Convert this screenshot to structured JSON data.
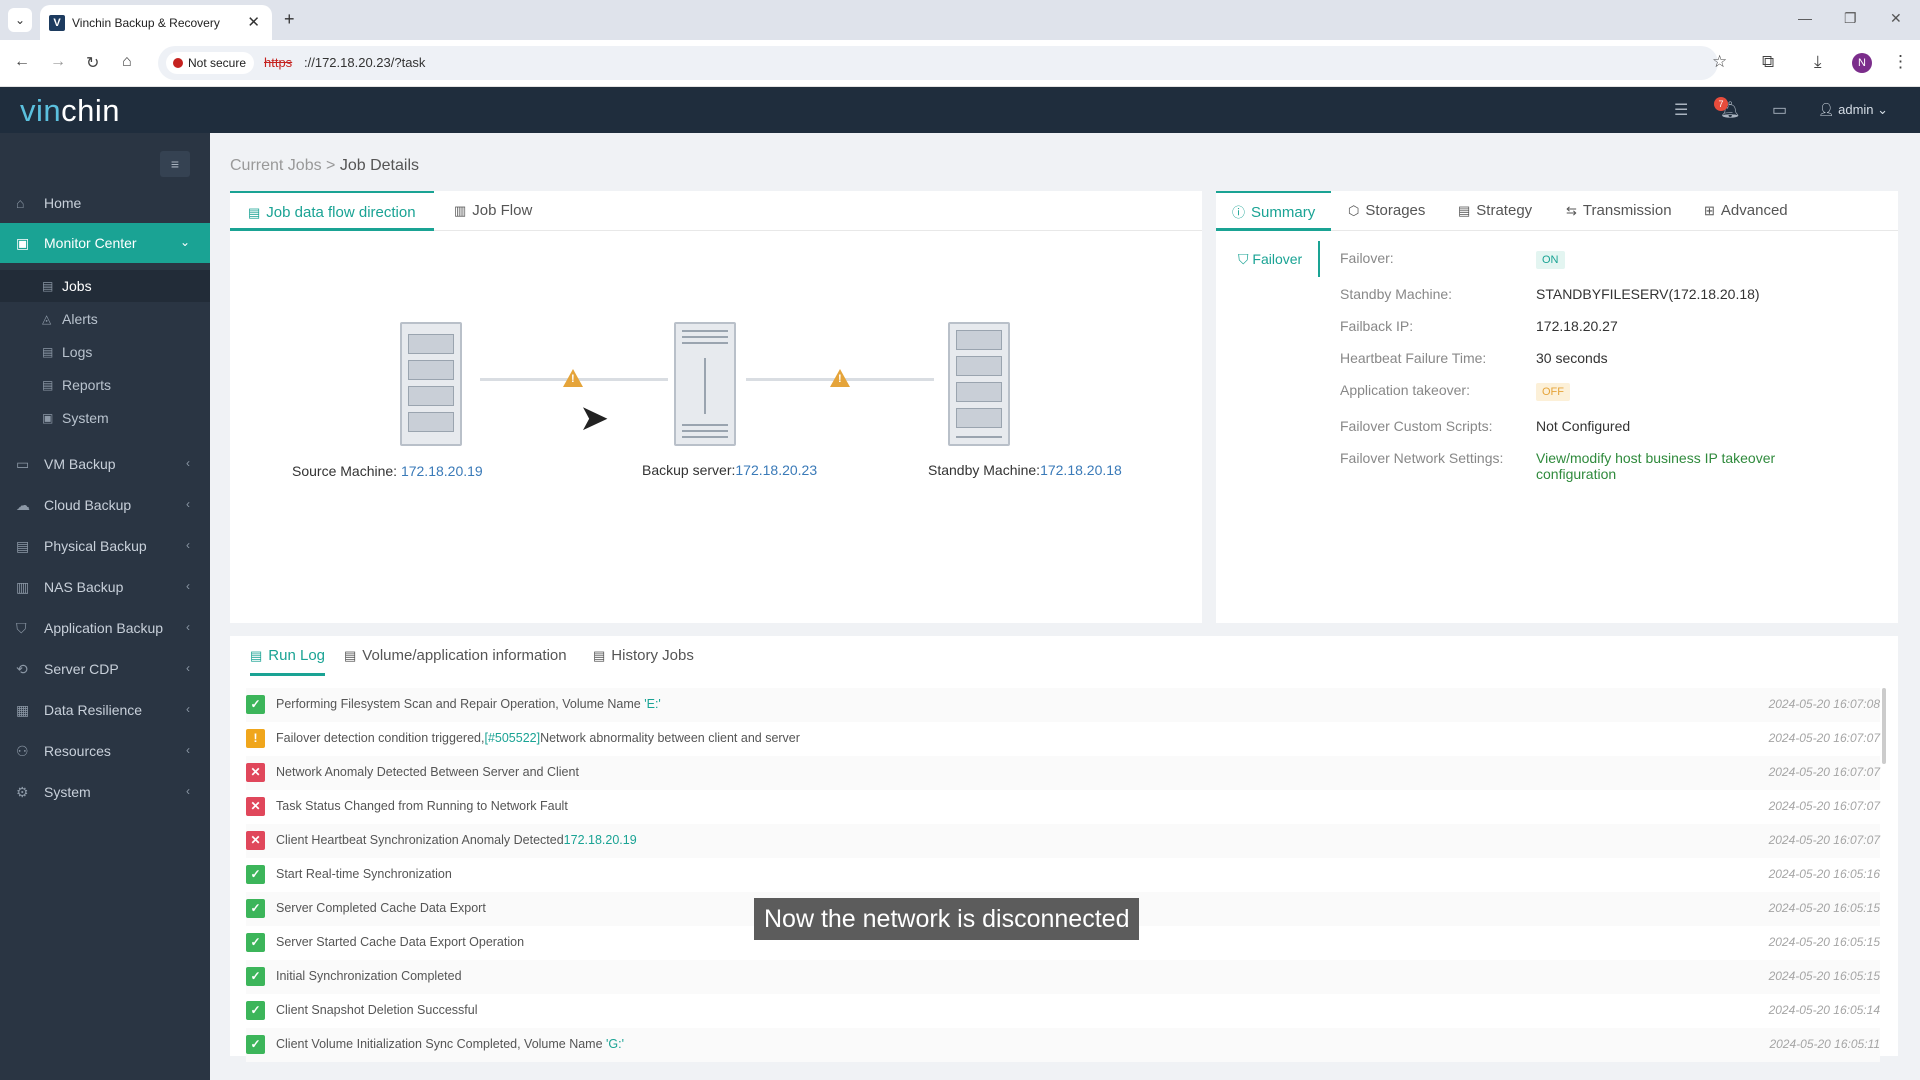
{
  "browser": {
    "tab_title": "Vinchin Backup & Recovery",
    "tab_favicon": "V",
    "not_secure": "Not secure",
    "url_scheme": "https",
    "url_rest": "://172.18.20.23/?task",
    "profile_initial": "N"
  },
  "header": {
    "logo_vin": "vin",
    "logo_chin": "chin",
    "notification_count": "7",
    "user": "admin"
  },
  "sidebar": {
    "home": "Home",
    "monitor_center": "Monitor Center",
    "monitor_sub": [
      "Jobs",
      "Alerts",
      "Logs",
      "Reports",
      "System"
    ],
    "sections": [
      "VM Backup",
      "Cloud Backup",
      "Physical Backup",
      "NAS Backup",
      "Application Backup",
      "Server CDP",
      "Data Resilience",
      "Resources",
      "System"
    ]
  },
  "breadcrumb": {
    "parent": "Current Jobs",
    "sep": ">",
    "current": "Job Details"
  },
  "flow_tabs": [
    "Job data flow direction",
    "Job Flow"
  ],
  "diagram": {
    "source_label": "Source Machine: ",
    "source_ip": "172.18.20.19",
    "backup_label": "Backup server:",
    "backup_ip": "172.18.20.23",
    "standby_label": "Standby Machine:",
    "standby_ip": "172.18.20.18"
  },
  "summary_tabs": [
    "Summary",
    "Storages",
    "Strategy",
    "Transmission",
    "Advanced"
  ],
  "summary": {
    "side_tab": "Failover",
    "rows": [
      {
        "key": "Failover:",
        "value": "ON"
      },
      {
        "key": "Standby Machine:",
        "value": "STANDBYFILESERV(172.18.20.18)"
      },
      {
        "key": "Failback IP:",
        "value": "172.18.20.27"
      },
      {
        "key": "Heartbeat Failure Time:",
        "value": "30 seconds"
      },
      {
        "key": "Application takeover:",
        "value": "OFF"
      },
      {
        "key": "Failover Custom Scripts:",
        "value": "Not Configured"
      },
      {
        "key": "Failover Network Settings:",
        "value": "View/modify host business IP takeover",
        "value2": "configuration"
      }
    ]
  },
  "log_tabs": [
    "Run Log",
    "Volume/application information",
    "History Jobs"
  ],
  "log": [
    {
      "status": "ok",
      "text": "Performing Filesystem Scan and Repair Operation, Volume Name ",
      "hl": "'E:'",
      "time": "2024-05-20 16:07:08"
    },
    {
      "status": "warn",
      "text": "Failover detection condition triggered,",
      "hl": "[#505522]",
      "text2": "Network abnormality between client and server",
      "time": "2024-05-20 16:07:07"
    },
    {
      "status": "err",
      "text": "Network Anomaly Detected Between Server and Client",
      "time": "2024-05-20 16:07:07"
    },
    {
      "status": "err",
      "text": "Task Status Changed from Running to Network Fault",
      "time": "2024-05-20 16:07:07"
    },
    {
      "status": "err",
      "text": "Client Heartbeat Synchronization Anomaly Detected",
      "hl": "172.18.20.19",
      "time": "2024-05-20 16:07:07"
    },
    {
      "status": "ok",
      "text": "Start Real-time Synchronization",
      "time": "2024-05-20 16:05:16"
    },
    {
      "status": "ok",
      "text": "Server Completed Cache Data Export",
      "time": "2024-05-20 16:05:15"
    },
    {
      "status": "ok",
      "text": "Server Started Cache Data Export Operation",
      "time": "2024-05-20 16:05:15"
    },
    {
      "status": "ok",
      "text": "Initial Synchronization Completed",
      "time": "2024-05-20 16:05:15"
    },
    {
      "status": "ok",
      "text": "Client Snapshot Deletion Successful",
      "time": "2024-05-20 16:05:14"
    },
    {
      "status": "ok",
      "text": "Client Volume Initialization Sync Completed, Volume Name ",
      "hl": "'G:'",
      "time": "2024-05-20 16:05:11"
    }
  ],
  "caption": "Now the network is disconnected",
  "colors": {
    "accent": "#1aa394",
    "sidebar": "#2a3543",
    "header": "#1f2d3d",
    "error": "#e0475b",
    "warning": "#f0a61c",
    "success": "#3cb55a"
  }
}
